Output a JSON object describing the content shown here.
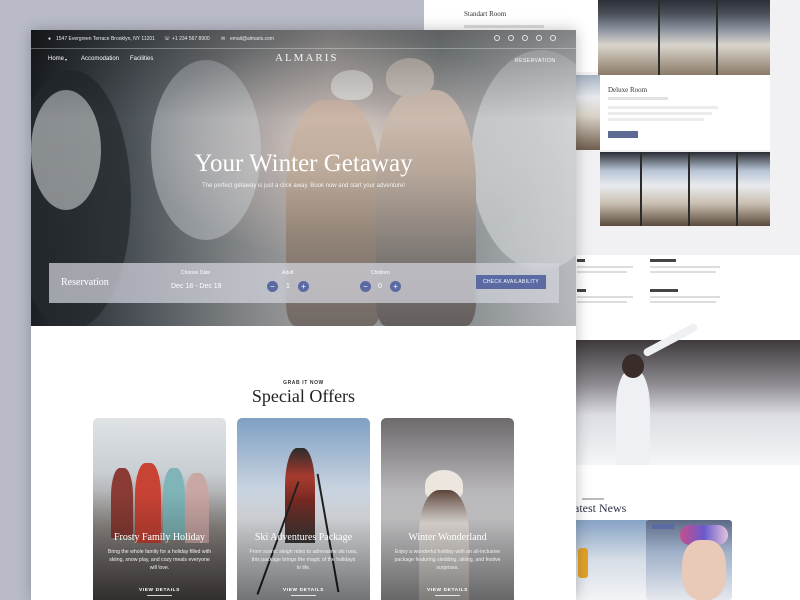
{
  "colors": {
    "accent": "#5b6aa2",
    "title_dark": "#2d3147",
    "frame_bg": "#b9bcc8"
  },
  "back_page": {
    "standard_room": {
      "title": "Standart Room"
    },
    "deluxe_room": {
      "title": "Deluxe Room"
    },
    "news_title": "atest News"
  },
  "topbar": {
    "address": "1547 Evergreen Terrace Brooklyn, NY 11201",
    "phone": "+1 234 567 8900",
    "email": "email@almaris.com"
  },
  "header": {
    "logo": "ALMARIS",
    "nav": [
      "Home",
      "Accomodation",
      "Facilities"
    ],
    "reservation_link": "RESERVATION",
    "social_icons": [
      "facebook-icon",
      "x-icon",
      "youtube-icon",
      "pinterest-icon",
      "instagram-icon"
    ]
  },
  "hero": {
    "title": "Your Winter Getaway",
    "subtitle": "The perfect getaway is just a click away. Book now and start your adventure!"
  },
  "reservation": {
    "label": "Reservation",
    "date_label": "Choose Date",
    "date_value": "Dec 18 - Dec 19",
    "adult_label": "Adult",
    "adult_value": "1",
    "children_label": "Children",
    "children_value": "0",
    "minus": "−",
    "plus": "+",
    "button": "CHECK AVAILABILITY"
  },
  "offers": {
    "eyebrow": "GRAB IT NOW",
    "title": "Special Offers",
    "cards": [
      {
        "title": "Frosty Family Holiday",
        "desc": "Bring the whole family for a holiday filled with skiing, snow play, and cozy meals everyone will love.",
        "link": "VIEW DETAILS"
      },
      {
        "title": "Ski Adventures Package",
        "desc": "From scenic sleigh rides to adrenaline ski runs, this package brings the magic of the holidays to life.",
        "link": "VIEW DETAILS"
      },
      {
        "title": "Winter Wonderland",
        "desc": "Enjoy a wonderful holiday with an all-inclusive package featuring sledding, skiing, and festive surprises.",
        "link": "VIEW DETAILS"
      }
    ]
  }
}
